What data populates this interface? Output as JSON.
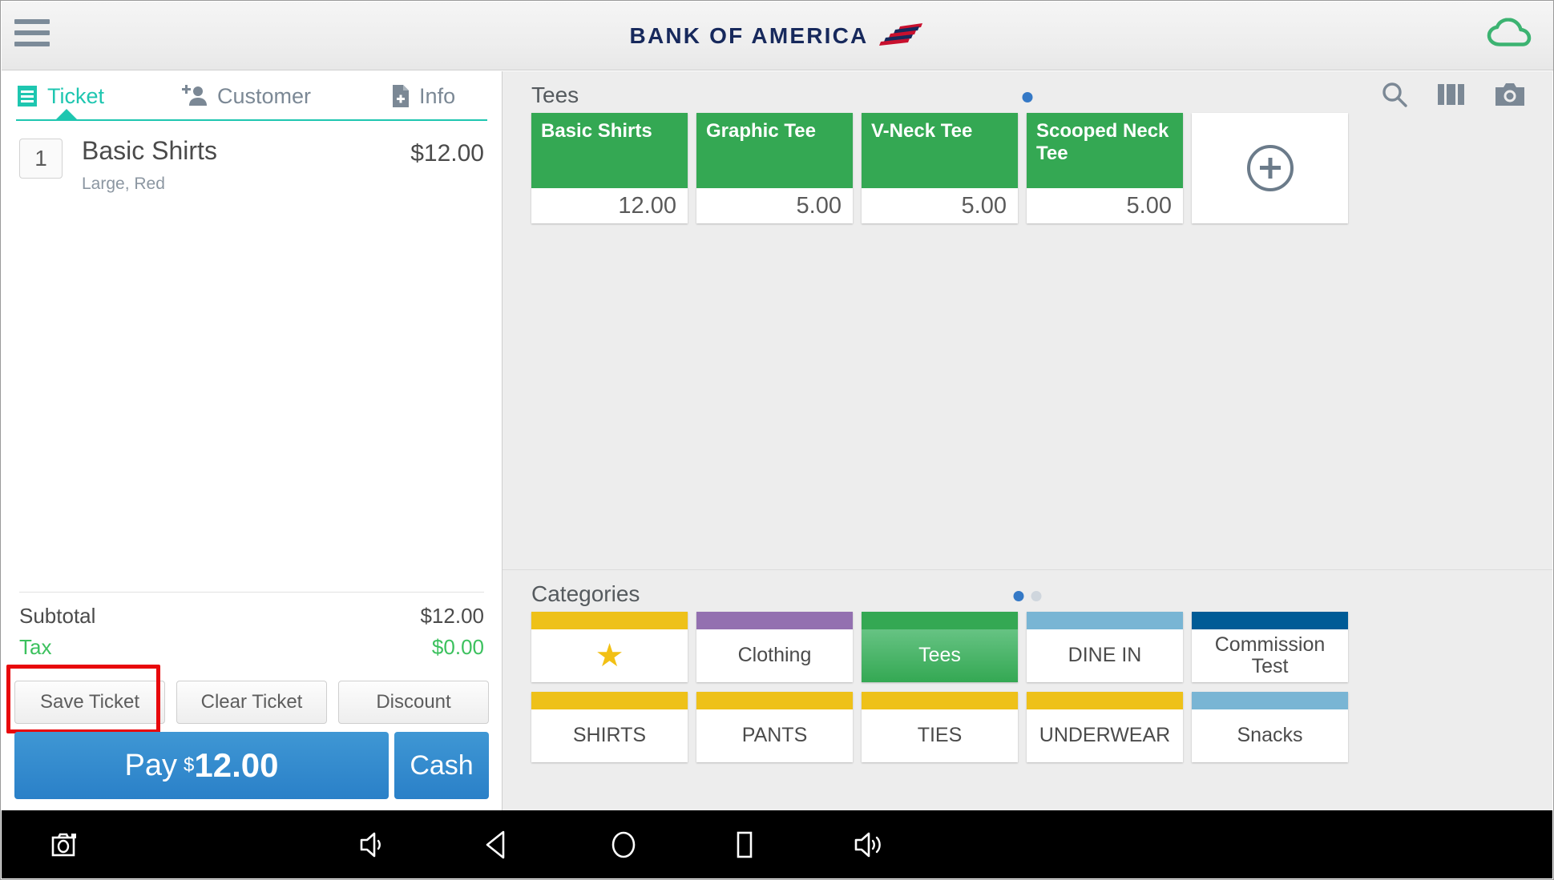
{
  "appbar": {
    "menu_icon": "hamburger-menu-icon",
    "brand_text": "BANK OF AMERICA",
    "brand_color": "#17295c",
    "cloud_icon": "cloud-icon",
    "cloud_color": "#3cb371"
  },
  "ticket_panel": {
    "tabs": [
      {
        "label": "Ticket",
        "icon": "receipt-icon",
        "active": true
      },
      {
        "label": "Customer",
        "icon": "add-person-icon",
        "active": false
      },
      {
        "label": "Info",
        "icon": "file-add-icon",
        "active": false
      }
    ],
    "accent_color": "#1ec6b0",
    "items": [
      {
        "qty": "1",
        "name": "Basic Shirts",
        "modifiers": "Large, Red",
        "price": "$12.00"
      }
    ],
    "totals": [
      {
        "label": "Subtotal",
        "value": "$12.00",
        "highlight": false
      },
      {
        "label": "Tax",
        "value": "$0.00",
        "highlight": true
      }
    ],
    "tax_color": "#3cc15e",
    "actions": [
      {
        "label": "Save Ticket",
        "highlighted": true
      },
      {
        "label": "Clear Ticket",
        "highlighted": false
      },
      {
        "label": "Discount",
        "highlighted": false
      }
    ],
    "pay": {
      "label": "Pay",
      "currency": "$",
      "amount": "12.00",
      "cash_label": "Cash",
      "color": "#2a80c8"
    },
    "highlight_color": "#e8080c"
  },
  "products": {
    "title": "Tees",
    "page_dots": {
      "count": 1,
      "active_index": 0
    },
    "header_icons": [
      "search-icon",
      "columns-icon",
      "camera-icon"
    ],
    "tile_color": "#34a853",
    "tiles": [
      {
        "name": "Basic Shirts",
        "price": "12.00"
      },
      {
        "name": "Graphic Tee",
        "price": "5.00"
      },
      {
        "name": "V-Neck Tee",
        "price": "5.00"
      },
      {
        "name": "Scooped Neck Tee",
        "price": "5.00"
      }
    ],
    "add_tile_icon": "plus-circle-icon"
  },
  "categories": {
    "title": "Categories",
    "page_dots": {
      "count": 2,
      "active_index": 0
    },
    "rows": [
      [
        {
          "label": "",
          "icon": "star-icon",
          "bar_color": "#eec119",
          "selected": false
        },
        {
          "label": "Clothing",
          "bar_color": "#9370b0",
          "selected": false
        },
        {
          "label": "Tees",
          "bar_color": "#34a853",
          "selected": true
        },
        {
          "label": "DINE IN",
          "bar_color": "#79b5d4",
          "selected": false
        },
        {
          "label": "Commission Test",
          "bar_color": "#005b96",
          "selected": false
        }
      ],
      [
        {
          "label": "SHIRTS",
          "bar_color": "#eec119",
          "selected": false
        },
        {
          "label": "PANTS",
          "bar_color": "#eec119",
          "selected": false
        },
        {
          "label": "TIES",
          "bar_color": "#eec119",
          "selected": false
        },
        {
          "label": "UNDERWEAR",
          "bar_color": "#eec119",
          "selected": false
        },
        {
          "label": "Snacks",
          "bar_color": "#79b5d4",
          "selected": false
        }
      ]
    ]
  },
  "navbar": {
    "buttons": [
      "screenshot-icon",
      "volume-down-icon",
      "back-icon",
      "home-icon",
      "recents-icon",
      "volume-up-icon"
    ]
  }
}
